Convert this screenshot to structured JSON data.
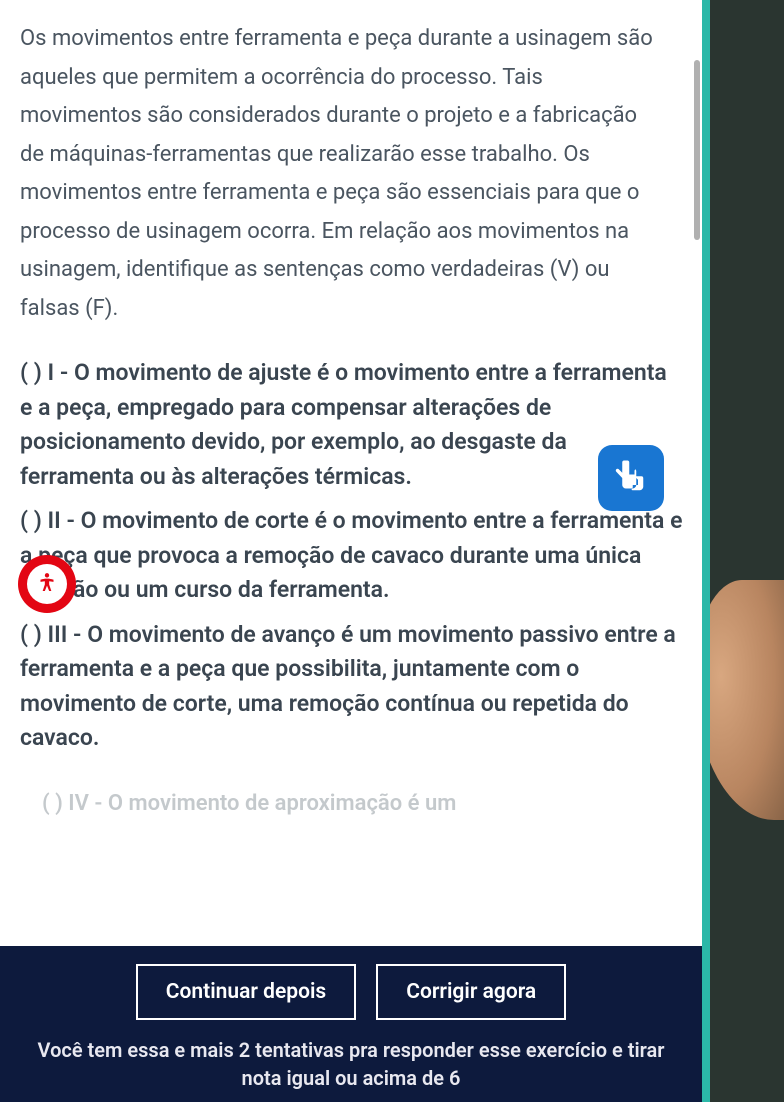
{
  "question": {
    "intro": "Os movimentos entre ferramenta e peça durante a usinagem são aqueles que permitem a ocorrência do processo. Tais movimentos são considerados durante o projeto e a fabricação de máquinas-ferramentas que realizarão esse trabalho. Os movimentos entre ferramenta e peça são essenciais para que o processo de usinagem ocorra. Em relação aos movimentos na usinagem, identifique as sentenças como verdadeiras (V) ou falsas (F).",
    "statements": [
      "( ) I - O movimento de ajuste é o movimento entre a ferramenta e a peça, empregado para compensar alterações de posicionamento devido, por exemplo, ao desgaste da ferramenta ou às alterações térmicas.",
      "( ) II - O movimento de corte é o movimento entre a ferramenta e a peça que provoca a remoção de cavaco durante uma única rotação ou um curso da ferramenta.",
      "( ) III - O movimento de avanço é um movimento passivo entre a ferramenta e a peça que possibilita, juntamente com o movimento de corte, uma remoção contínua ou repetida do cavaco."
    ],
    "partial_next": "( ) IV - O movimento de aproximação é um"
  },
  "buttons": {
    "continue_later": "Continuar depois",
    "correct_now": "Corrigir agora"
  },
  "footer": {
    "attempts_text": "Você tem essa e mais 2 tentativas pra responder esse exercício e tirar nota igual ou acima de 6"
  }
}
